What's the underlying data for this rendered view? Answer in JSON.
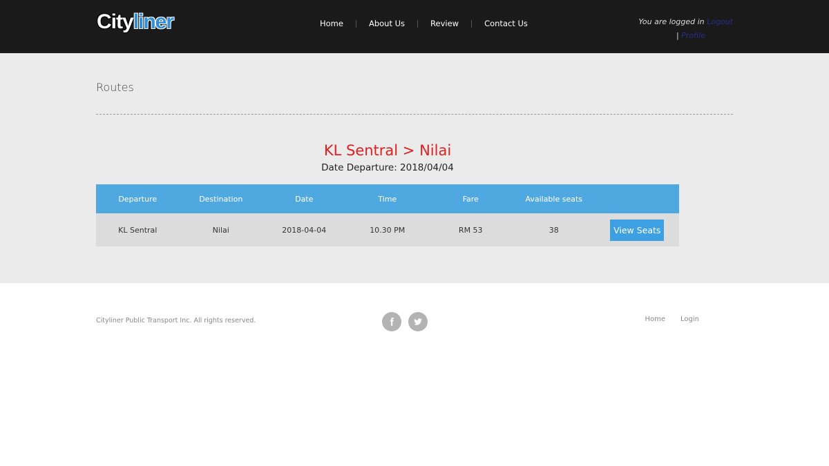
{
  "brand": {
    "part1": "City",
    "part2": "liner"
  },
  "nav": {
    "items": [
      "Home",
      "About Us",
      "Review",
      "Contact Us"
    ]
  },
  "session": {
    "status_text": "You are logged in",
    "logout_label": "Logout",
    "separator": "|",
    "profile_label": "Profile"
  },
  "page": {
    "title": "Routes"
  },
  "route": {
    "heading": "KL Sentral > Nilai",
    "date_text": "Date Departure: 2018/04/04"
  },
  "table": {
    "columns": [
      "Departure",
      "Destination",
      "Date",
      "Time",
      "Fare",
      "Available seats"
    ],
    "rows": [
      {
        "departure": "KL Sentral",
        "destination": "Nilai",
        "date": "2018-04-04",
        "time": "10.30 PM",
        "fare": "RM 53",
        "seats": "38",
        "action_label": "View Seats"
      }
    ]
  },
  "footer": {
    "copyright": "Cityliner Public Transport Inc. All rights reserved.",
    "social": [
      "facebook-icon",
      "twitter-icon"
    ],
    "links": [
      "Home",
      "Login"
    ]
  },
  "colors": {
    "header_bg": "#1a1a1a",
    "accent": "#50a8e0",
    "route_heading": "#e02020",
    "button": "#3da0e3"
  }
}
